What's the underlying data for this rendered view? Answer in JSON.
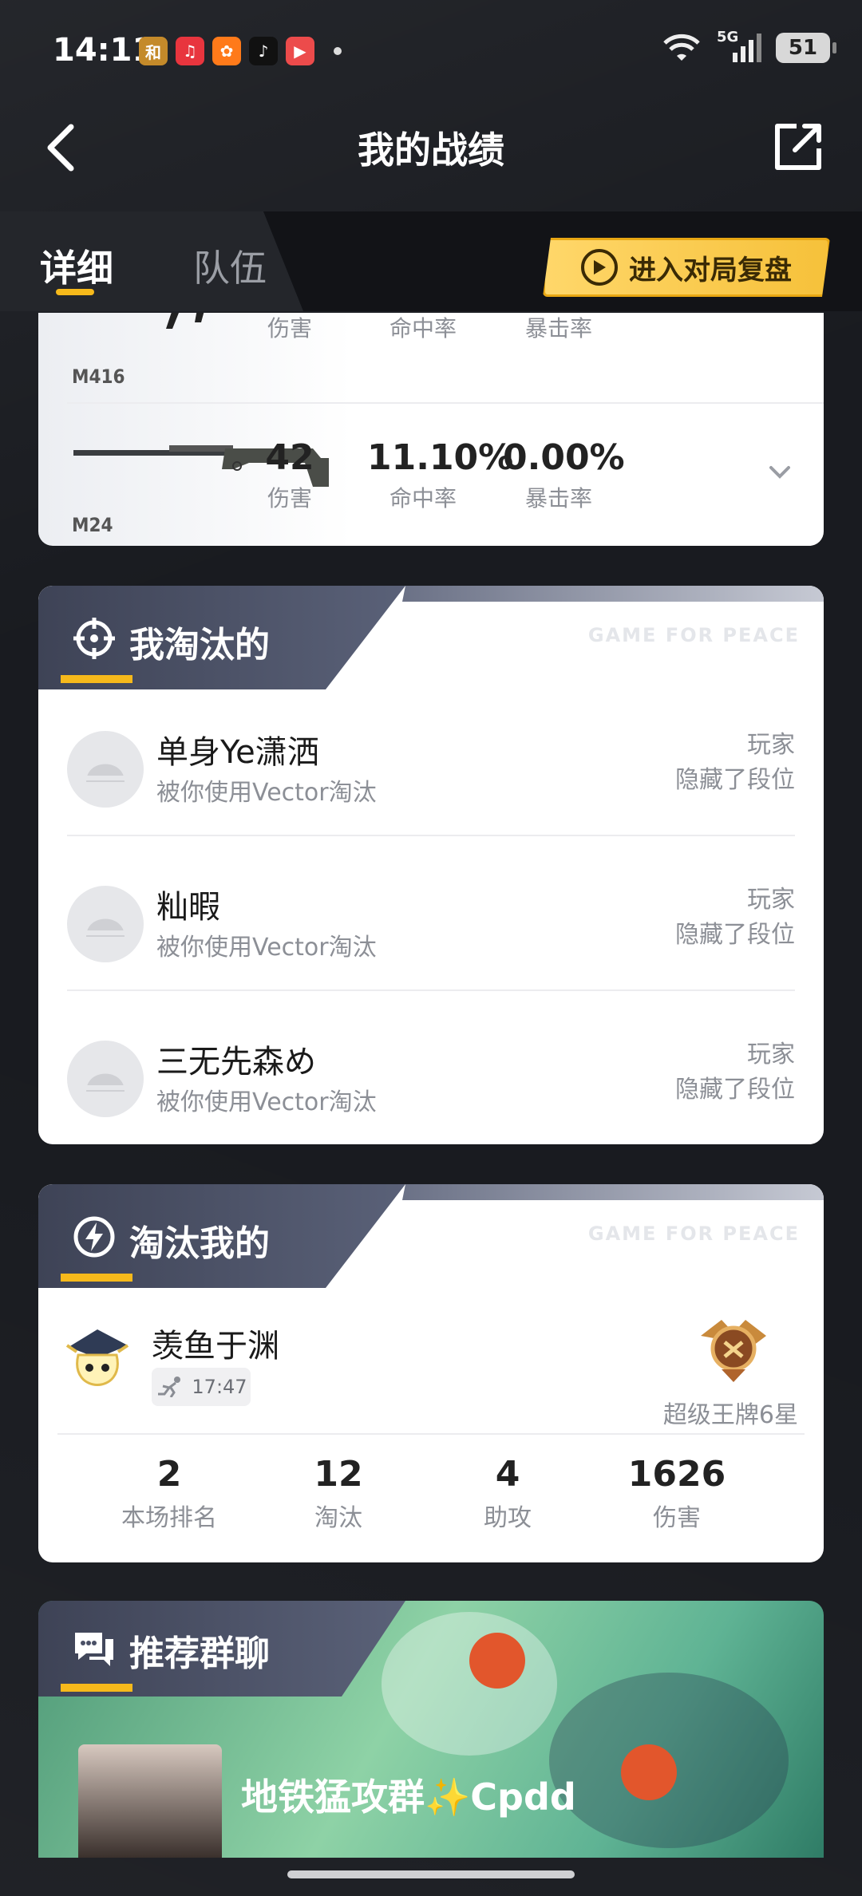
{
  "status_bar": {
    "time": "14:11",
    "battery": "51",
    "network": "5G",
    "apps": [
      {
        "name": "game-app-icon",
        "color": "#c48a2a",
        "glyph": "和"
      },
      {
        "name": "music-app-icon",
        "color": "#e8353e",
        "glyph": "♫"
      },
      {
        "name": "orange-app-icon",
        "color": "#ff7a1a",
        "glyph": "✿"
      },
      {
        "name": "tiktok-app-icon",
        "color": "#111111",
        "glyph": "♪"
      },
      {
        "name": "video-app-icon",
        "color": "#ec4b4b",
        "glyph": "▶"
      }
    ]
  },
  "header": {
    "title": "我的战绩"
  },
  "tabs": [
    {
      "label": "详细",
      "active": true
    },
    {
      "label": "队伍",
      "active": false
    }
  ],
  "replay_button": {
    "label": "进入对局复盘"
  },
  "weapons": [
    {
      "name": "M416",
      "stats": [
        {
          "value": "",
          "label": "伤害"
        },
        {
          "value": "",
          "label": "命中率"
        },
        {
          "value": "",
          "label": "暴击率"
        }
      ]
    },
    {
      "name": "M24",
      "stats": [
        {
          "value": "42",
          "label": "伤害"
        },
        {
          "value": "11.10%",
          "label": "命中率"
        },
        {
          "value": "0.00%",
          "label": "暴击率"
        }
      ]
    }
  ],
  "eliminated_by_me": {
    "title": "我淘汰的",
    "watermark": "GAME FOR PEACE",
    "players": [
      {
        "name": "单身Ye潇洒",
        "desc": "被你使用Vector淘汰",
        "role": "玩家",
        "rank": "隐藏了段位"
      },
      {
        "name": "籼暇",
        "desc": "被你使用Vector淘汰",
        "role": "玩家",
        "rank": "隐藏了段位"
      },
      {
        "name": "三无先森め",
        "desc": "被你使用Vector淘汰",
        "role": "玩家",
        "rank": "隐藏了段位"
      }
    ]
  },
  "eliminated_me": {
    "title": "淘汰我的",
    "watermark": "GAME FOR PEACE",
    "killer": {
      "name": "羡鱼于渊",
      "time": "17:47",
      "rank": "超级王牌6星"
    },
    "stats": [
      {
        "value": "2",
        "label": "本场排名"
      },
      {
        "value": "12",
        "label": "淘汰"
      },
      {
        "value": "4",
        "label": "助攻"
      },
      {
        "value": "1626",
        "label": "伤害"
      }
    ]
  },
  "recommended_groups": {
    "title": "推荐群聊",
    "group_name": "地铁猛攻群✨Cpdd"
  },
  "colors": {
    "accent": "#f6b91b",
    "background": "#17191d",
    "section_header": "#4a5066"
  }
}
